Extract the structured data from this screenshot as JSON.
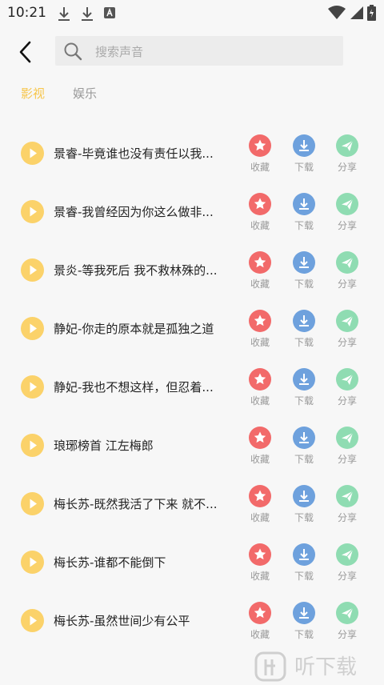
{
  "status_bar": {
    "time": "10:21"
  },
  "search": {
    "placeholder": "搜索声音",
    "value": ""
  },
  "tabs": [
    {
      "label": "影视",
      "active": true
    },
    {
      "label": "娱乐",
      "active": false
    }
  ],
  "actions": {
    "favorite": "收藏",
    "download": "下载",
    "share": "分享"
  },
  "items": [
    {
      "title": "景睿-毕竟谁也没有责任以我..."
    },
    {
      "title": "景睿-我曾经因为你这么做非..."
    },
    {
      "title": "景炎-等我死后 我不救林殊的..."
    },
    {
      "title": "静妃-你走的原本就是孤独之道"
    },
    {
      "title": "静妃-我也不想这样，但忍着..."
    },
    {
      "title": "琅琊榜首 江左梅郎"
    },
    {
      "title": "梅长苏-既然我活了下来 就不..."
    },
    {
      "title": "梅长苏-谁都不能倒下"
    },
    {
      "title": "梅长苏-虽然世间少有公平"
    }
  ],
  "watermark": {
    "text": "听下载"
  },
  "colors": {
    "accent": "#f7c64b",
    "play": "#fbd26a",
    "favorite": "#f26a6a",
    "download": "#6ea1dd",
    "share": "#8fdcb2"
  },
  "icons": {
    "back": "chevron-left-icon",
    "search": "search-icon",
    "play": "play-icon",
    "favorite": "star-icon",
    "download": "download-icon",
    "share": "send-icon"
  }
}
